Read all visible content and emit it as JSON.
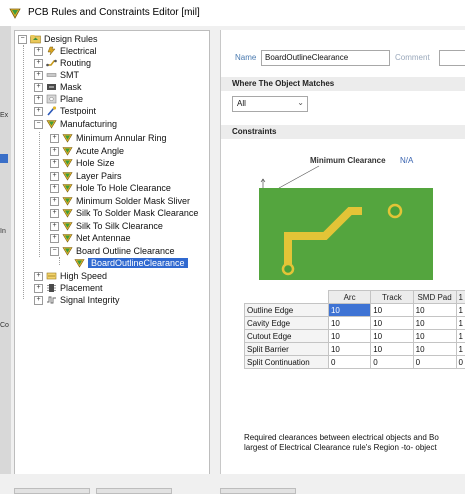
{
  "window": {
    "title": "PCB Rules and Constraints Editor [mil]"
  },
  "side_marks": [
    "Ex",
    "In",
    "Co"
  ],
  "tree": {
    "root": "Design Rules",
    "categories": [
      "Electrical",
      "Routing",
      "SMT",
      "Mask",
      "Plane",
      "Testpoint",
      "Manufacturing"
    ],
    "manufacturing_children": [
      "Minimum Annular Ring",
      "Acute Angle",
      "Hole Size",
      "Layer Pairs",
      "Hole To Hole Clearance",
      "Minimum Solder Mask Sliver",
      "Silk To Solder Mask Clearance",
      "Silk To Silk Clearance",
      "Net Antennae",
      "Board Outline Clearance"
    ],
    "selected_rule": "BoardOutlineClearance",
    "after": [
      "High Speed",
      "Placement",
      "Signal Integrity"
    ]
  },
  "rule": {
    "name_label": "Name",
    "name_value": "BoardOutlineClearance",
    "comment_label": "Comment"
  },
  "where": {
    "header": "Where The Object Matches",
    "scope": "All"
  },
  "constraints": {
    "header": "Constraints",
    "min_clearance_label": "Minimum Clearance",
    "min_clearance_value": "N/A",
    "columns": [
      "",
      "Arc",
      "Track",
      "SMD Pad",
      "1"
    ],
    "rows": [
      {
        "label": "Outline Edge",
        "values": [
          "10",
          "10",
          "10",
          "1"
        ]
      },
      {
        "label": "Cavity Edge",
        "values": [
          "10",
          "10",
          "10",
          "1"
        ]
      },
      {
        "label": "Cutout Edge",
        "values": [
          "10",
          "10",
          "10",
          "1"
        ]
      },
      {
        "label": "Split Barrier",
        "values": [
          "10",
          "10",
          "10",
          "1"
        ]
      },
      {
        "label": "Split Continuation",
        "values": [
          "0",
          "0",
          "0",
          "0"
        ]
      }
    ],
    "description_line1": "Required clearances between electrical objects and Bo",
    "description_line2": "largest of Electrical Clearance rule's Region -to- object"
  },
  "colors": {
    "board": "#54a53e",
    "track": "#e3c437",
    "selection": "#3069d0"
  },
  "icons": {
    "title": "rules-editor-icon",
    "rule": "rule-icon"
  }
}
